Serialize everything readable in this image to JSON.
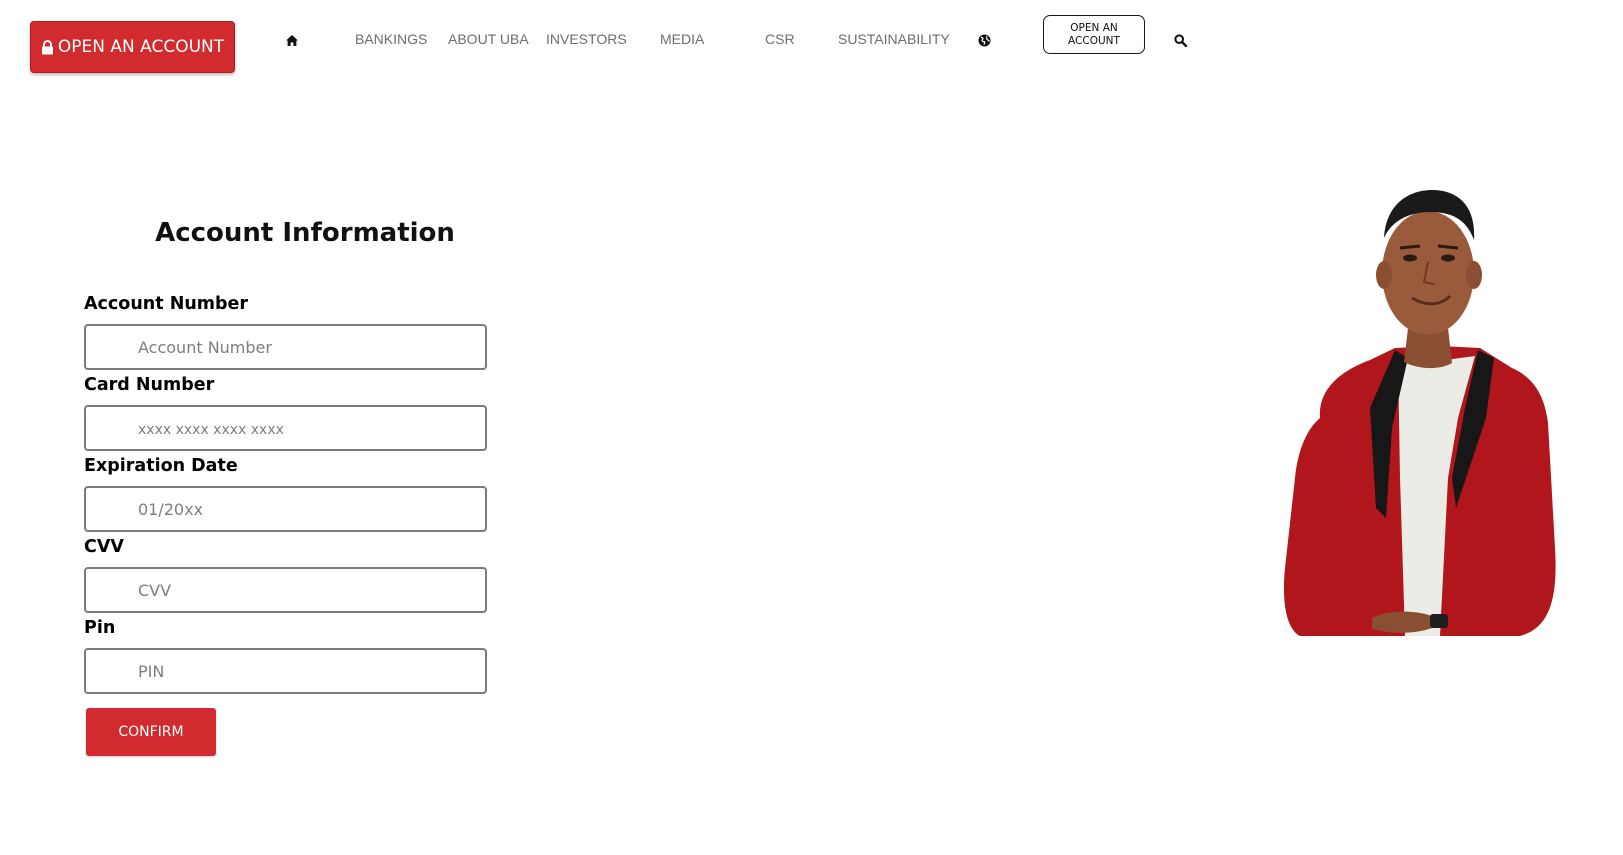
{
  "header": {
    "primary_button": {
      "label": "OPEN AN ACCOUNT",
      "icon": "lock-icon"
    },
    "nav": {
      "home_icon": "home-icon",
      "links": [
        "BANKINGS",
        "ABOUT UBA",
        "INVESTORS",
        "MEDIA",
        "CSR",
        "SUSTAINABILITY"
      ],
      "globe_icon": "globe-icon",
      "outline_button": "OPEN AN ACCOUNT",
      "search_icon": "search-icon"
    }
  },
  "form": {
    "title": "Account Information",
    "fields": [
      {
        "label": "Account Number",
        "placeholder": "Account Number",
        "value": ""
      },
      {
        "label": "Card Number",
        "placeholder": "xxxx xxxx xxxx xxxx",
        "value": ""
      },
      {
        "label": "Expiration Date",
        "placeholder": "01/20xx",
        "value": ""
      },
      {
        "label": "CVV",
        "placeholder": "CVV",
        "value": ""
      },
      {
        "label": "Pin",
        "placeholder": "PIN",
        "value": ""
      }
    ],
    "submit_label": "CONFIRM"
  },
  "colors": {
    "brand_red": "#d22b2f",
    "nav_text": "#6d6d6d",
    "input_border": "#7b7b7b"
  }
}
